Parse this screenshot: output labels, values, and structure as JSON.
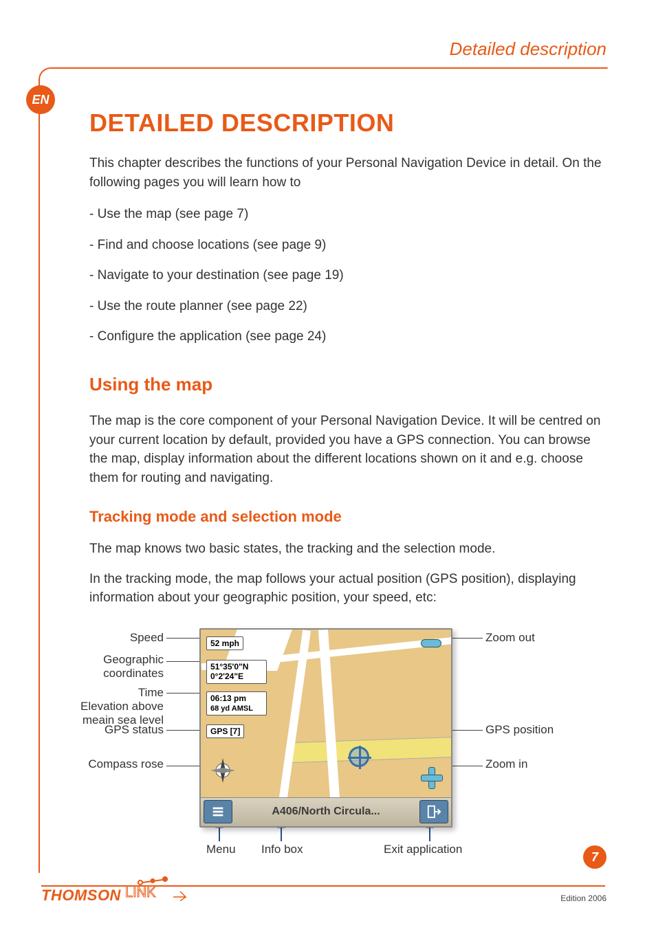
{
  "header": {
    "title": "Detailed description"
  },
  "lang_badge": "EN",
  "main_heading": "DETAILED DESCRIPTION",
  "intro": "This chapter describes the functions of your Personal Navigation Device in detail. On the following pages you will learn how to",
  "list": [
    "- Use the map (see page 7)",
    "- Find and choose locations (see page 9)",
    "- Navigate to your destination (see page 19)",
    "- Use the route planner (see page 22)",
    "- Configure the application (see page 24)"
  ],
  "section_heading": "Using the map",
  "section_body": "The map is the core component of your Personal Navigation Device. It will be centred on your current location by default, provided you have a GPS connection. You can browse the map, display information about the different locations shown on it and e.g. choose them for routing and navigating.",
  "subsection_heading": "Tracking mode and selection mode",
  "sub_body_1": "The map knows two basic states, the tracking and the selection mode.",
  "sub_body_2": "In the tracking mode, the map follows your actual position (GPS position), displaying information about your geographic position, your speed, etc:",
  "map": {
    "speed": "52 mph",
    "coords_lat": "51°35'0\"N",
    "coords_lon": "0°2'24\"E",
    "time": "06:13 pm",
    "elevation": "68 yd AMSL",
    "gps": "GPS [7]",
    "infobox": "A406/North Circula..."
  },
  "labels": {
    "speed": "Speed",
    "coords": "Geographic\ncoordinates",
    "time": "Time",
    "elev": "Elevation above\nmeain sea level",
    "gps_status": "GPS status",
    "compass": "Compass rose",
    "zoom_out": "Zoom out",
    "gps_pos": "GPS position",
    "zoom_in": "Zoom in",
    "menu": "Menu",
    "infobox": "Info box",
    "exit": "Exit application"
  },
  "page_number": "7",
  "edition": "Edition 2006",
  "logo": {
    "brand": "THOMSON"
  }
}
